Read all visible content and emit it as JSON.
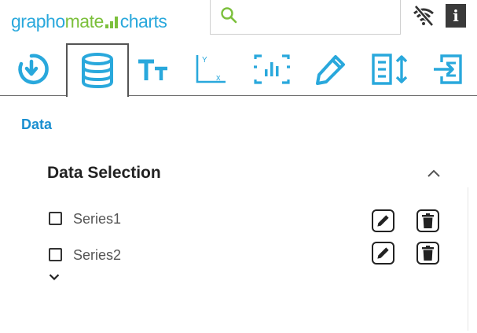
{
  "header": {
    "logo": {
      "part1": "grapho",
      "part2": "mate",
      "part3": "charts"
    },
    "search": {
      "placeholder": "",
      "value": ""
    },
    "icons": [
      "wifi-off-icon",
      "info-icon"
    ],
    "info_label": "i"
  },
  "tabs": [
    {
      "name": "history-icon",
      "active": false
    },
    {
      "name": "database-icon",
      "active": true
    },
    {
      "name": "text-size-icon",
      "active": false
    },
    {
      "name": "axes-icon",
      "active": false
    },
    {
      "name": "focus-chart-icon",
      "active": false
    },
    {
      "name": "pencil-icon",
      "active": false
    },
    {
      "name": "sort-list-icon",
      "active": false
    },
    {
      "name": "export-icon",
      "active": false
    }
  ],
  "main": {
    "section_title": "Data",
    "panel": {
      "title": "Data Selection",
      "series": [
        {
          "label": "Series1",
          "checked": false
        },
        {
          "label": "Series2",
          "checked": false
        }
      ]
    }
  },
  "colors": {
    "accent": "#1a8fd0",
    "logo_blue": "#29a8dc",
    "logo_green": "#7cc03c"
  }
}
